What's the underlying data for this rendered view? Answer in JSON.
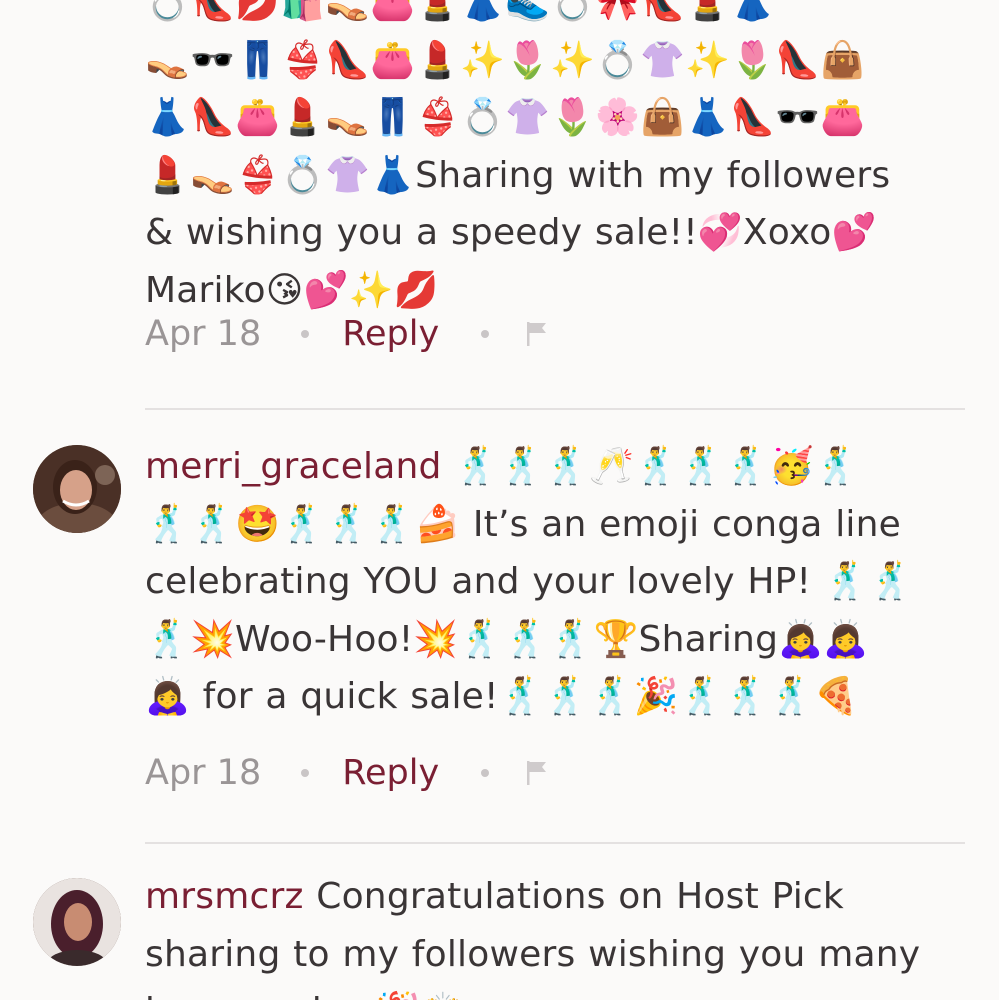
{
  "comments": [
    {
      "username": "",
      "text_lines": [
        "💍👠💋🛍️👡👛💄👗👟💍🎀👠💄👗",
        "👡🕶️👖👙👠👛💄✨🌷✨💍👚✨🌷👠👜",
        "👗👠👛💄👡👖👙💍👚🌷🌸👜👗👠🕶️👛",
        "💄👡👙💍👚👗Sharing with my followers",
        "& wishing you a speedy sale!!💞Xoxo💕",
        "Mariko😘💕✨💋"
      ],
      "date": "Apr 18",
      "reply_label": "Reply"
    },
    {
      "username": "merri_graceland",
      "text_lines": [
        " 🕺🕺🕺🥂🕺🕺🕺🥳🕺",
        "🕺🕺🤩🕺🕺🕺🍰 It’s an emoji conga line",
        "celebrating YOU and your lovely HP! 🕺🕺",
        "🕺💥Woo-Hoo!💥🕺🕺🕺🏆Sharing🙇‍♀️🙇‍♀️",
        "🙇‍♀️ for a quick sale!🕺🕺🕺🎉🕺🕺🕺🍕"
      ],
      "date": "Apr 18",
      "reply_label": "Reply"
    },
    {
      "username": "mrsmcrz",
      "text_lines": [
        " Congratulations on Host Pick",
        "sharing to my followers wishing you many",
        "happy sales 🎉🙌"
      ]
    }
  ]
}
